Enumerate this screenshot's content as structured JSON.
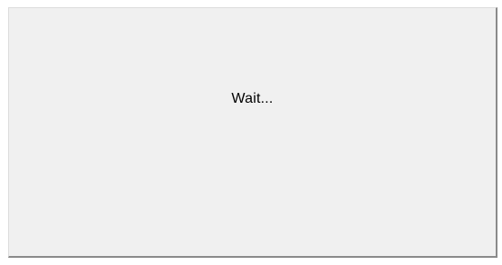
{
  "dialog": {
    "message": "Wait...",
    "background_color": "#f0f0f0",
    "text_color": "#000000"
  }
}
